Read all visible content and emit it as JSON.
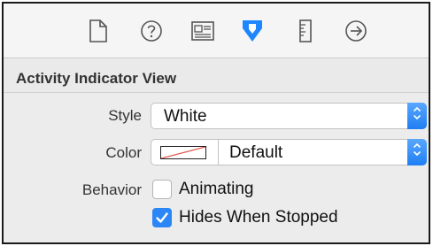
{
  "tabs": [
    {
      "icon": "file-icon"
    },
    {
      "icon": "help-icon"
    },
    {
      "icon": "identity-icon"
    },
    {
      "icon": "attributes-icon",
      "selected": true
    },
    {
      "icon": "ruler-icon"
    },
    {
      "icon": "connections-icon"
    }
  ],
  "section": {
    "title": "Activity Indicator View"
  },
  "style": {
    "label": "Style",
    "value": "White"
  },
  "color": {
    "label": "Color",
    "value": "Default"
  },
  "behavior": {
    "label": "Behavior",
    "animating": {
      "label": "Animating",
      "checked": false
    },
    "hides_when_stopped": {
      "label": "Hides When Stopped",
      "checked": true
    }
  },
  "colors": {
    "accent": "#1f7ef2",
    "selected_tab": "#1e86ff"
  }
}
